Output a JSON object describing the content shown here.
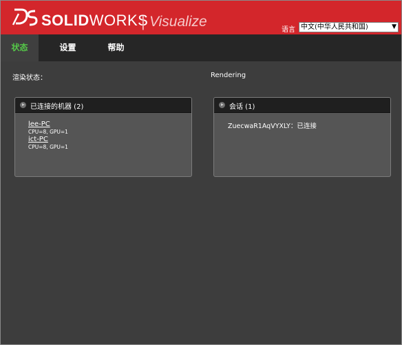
{
  "brand": {
    "name_bold": "SOLID",
    "name_light": "WORKS",
    "separator": "|",
    "product": "Visualize"
  },
  "language": {
    "label": "语言",
    "selected": "中文(中华人民共和国)"
  },
  "tabs": [
    {
      "label": "状态",
      "active": true
    },
    {
      "label": "设置",
      "active": false
    },
    {
      "label": "帮助",
      "active": false
    }
  ],
  "render_status": {
    "label": "渲染状态：",
    "value": "Rendering"
  },
  "machines_panel": {
    "title": "已连接的机器 (2)",
    "machines": [
      {
        "name": "lee-PC",
        "spec": "CPU=8, GPU=1"
      },
      {
        "name": "ict-PC",
        "spec": "CPU=8, GPU=1"
      }
    ]
  },
  "sessions_panel": {
    "title": "会话 (1)",
    "sessions": [
      {
        "text": "ZuecwaR1AqVYXLY：已连接"
      }
    ]
  },
  "colors": {
    "header_red": "#d3262b",
    "active_tab_green": "#55c848",
    "nav_bg": "#262626",
    "body_bg": "#3d3d3d",
    "panel_bg": "#555555"
  }
}
